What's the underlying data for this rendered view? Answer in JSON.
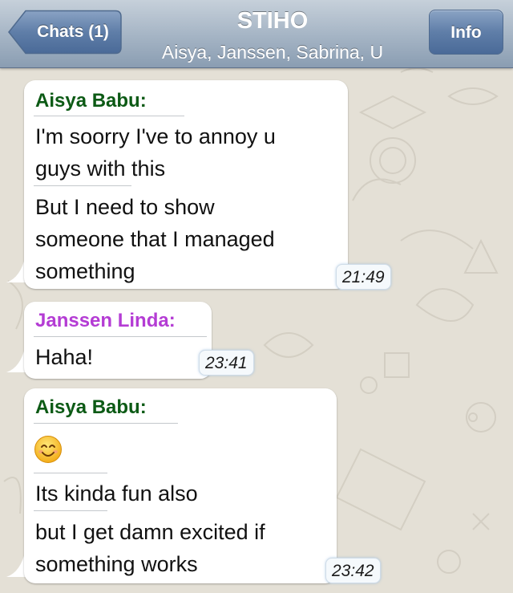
{
  "nav": {
    "back_label": "Chats (1)",
    "title": "STIHO",
    "subtitle": "Aisya, Janssen, Sabrina, U",
    "info_label": "Info"
  },
  "colors": {
    "aisya_name": "#0c5a15",
    "janssen_name": "#b43cd4"
  },
  "messages": [
    {
      "sender": "Aisya Babu:",
      "lines": [
        "I'm soorry I've to annoy u",
        "guys with this",
        "But I need to show",
        "someone that I managed",
        "something"
      ],
      "time": "21:49"
    },
    {
      "sender": "Janssen Linda:",
      "lines": [
        "Haha!"
      ],
      "time": "23:41"
    },
    {
      "sender": "Aisya Babu:",
      "emoji": "smiling-face-emoji",
      "lines": [
        "Its kinda fun also",
        "but I get damn excited if",
        "something works"
      ],
      "time": "23:42"
    }
  ]
}
